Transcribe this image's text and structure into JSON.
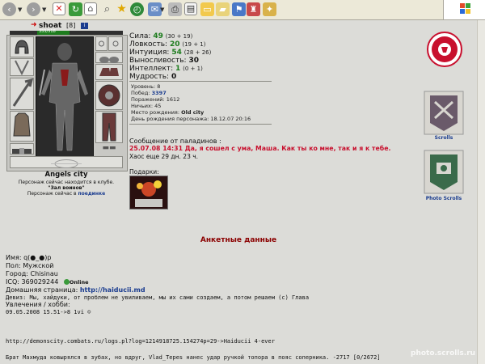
{
  "character": {
    "name": "shoat",
    "level": "[8]",
    "hp": "355/518",
    "city": "Angels city",
    "club_line": "Персонаж сейчас находится в клубе.",
    "room": "\"Зал воинов\"",
    "fight_line_prefix": "Персонаж сейчас в",
    "fight_link": "поединке"
  },
  "stats": [
    {
      "label": "Сила:",
      "value": "49",
      "bonus": "(30 + 19)"
    },
    {
      "label": "Ловкость:",
      "value": "20",
      "bonus": "(19 + 1)"
    },
    {
      "label": "Интуиция:",
      "value": "54",
      "bonus": "(28 + 26)"
    },
    {
      "label": "Выносливость:",
      "value": "30",
      "bonus": ""
    },
    {
      "label": "Интеллект:",
      "value": "1",
      "bonus": "(0 + 1)"
    },
    {
      "label": "Мудрость:",
      "value": "0",
      "bonus": ""
    }
  ],
  "info": {
    "level": "Уровень: 8",
    "wins_label": "Побед:",
    "wins": "3397",
    "losses": "Поражений: 1612",
    "draws": "Ничьих: 45",
    "birthplace_label": "Место рождения:",
    "birthplace": "Old city",
    "birthday": "День рождения персонажа: 18.12.07 20:16"
  },
  "paladin": {
    "header": "Сообщение от паладинов :",
    "message": "25.07.08 14:31 Да, я сошел с ума, Маша. Как ты ко мне, так и я к тебе.",
    "chaos": "Хаос еще 29 дн. 23 ч."
  },
  "gifts_label": "Подарки:",
  "sidebar": {
    "scrolls_label": "Scrolls",
    "photo_scrolls_label": "Photo Scrolls"
  },
  "profile": {
    "title": "Анкетные данные",
    "name_line": "Имя: q(●_●)p",
    "gender": "Пол: Мужской",
    "city": "Город: Chisinau",
    "icq": "ICQ: 369029244",
    "online": "Online",
    "homepage_label": "Домашняя страница:",
    "homepage": "http://haiducii.md",
    "motto": "Девиз: Мы, хайдуки, от проблем не увиливаем, мы их сами создаем, а потом решаем (c) Глава",
    "hobbies": "Увлечения / хобби:",
    "date_line": "09.05.2008 15.51->8 1vi ☺",
    "log_url": "http://demonscity.combats.ru/logs.pl?log=1214918725.154274p=29->Haiducii  4-ever",
    "bottom_line": "Брат Махмуда ковырялся в зубах, но вдруг, Vlad_Tepes нанес удар ручкой топора в пояс соперника. -2717 [0/2672]"
  },
  "watermark": "photo.scrolls.ru",
  "colors": {
    "red": "#c8102e",
    "green": "#1d7c1d",
    "blue": "#1a3c8f",
    "maroon": "#8b0000"
  }
}
